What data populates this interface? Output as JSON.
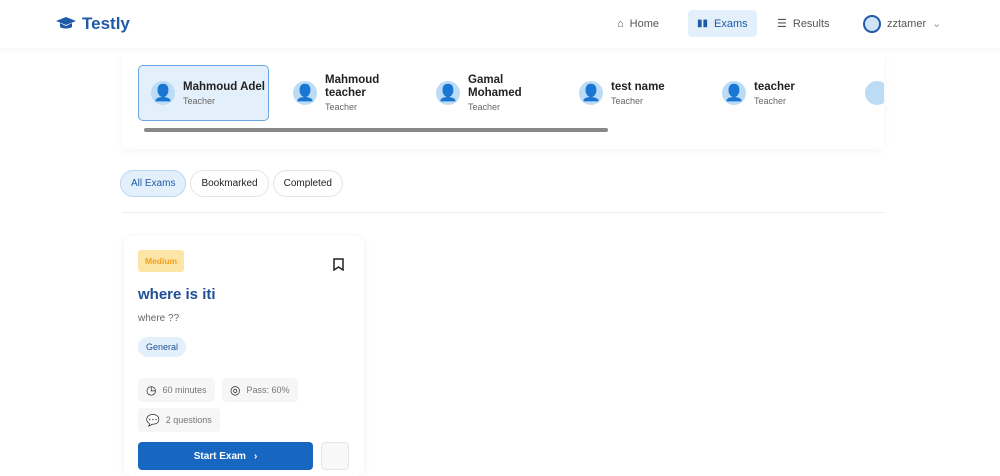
{
  "nav": {
    "brand": "Testly",
    "items": [
      {
        "label": "Home",
        "icon": "home-icon"
      },
      {
        "label": "Exams",
        "icon": "book-icon"
      },
      {
        "label": "Results",
        "icon": "list-icon"
      }
    ],
    "user": "zztamer"
  },
  "teachers": [
    {
      "name": "Mahmoud Adel",
      "role": "Teacher"
    },
    {
      "name": "Mahmoud teacher",
      "role": "Teacher"
    },
    {
      "name": "Gamal Mohamed",
      "role": "Teacher"
    },
    {
      "name": "test name",
      "role": "Teacher"
    },
    {
      "name": "teacher",
      "role": "Teacher"
    }
  ],
  "filters": [
    "All Exams",
    "Bookmarked",
    "Completed"
  ],
  "exam": {
    "difficulty": "Medium",
    "title": "where is iti",
    "description": "where ??",
    "category": "General",
    "duration": "60 minutes",
    "pass": "Pass: 60%",
    "questions": "2 questions",
    "start_label": "Start Exam"
  }
}
